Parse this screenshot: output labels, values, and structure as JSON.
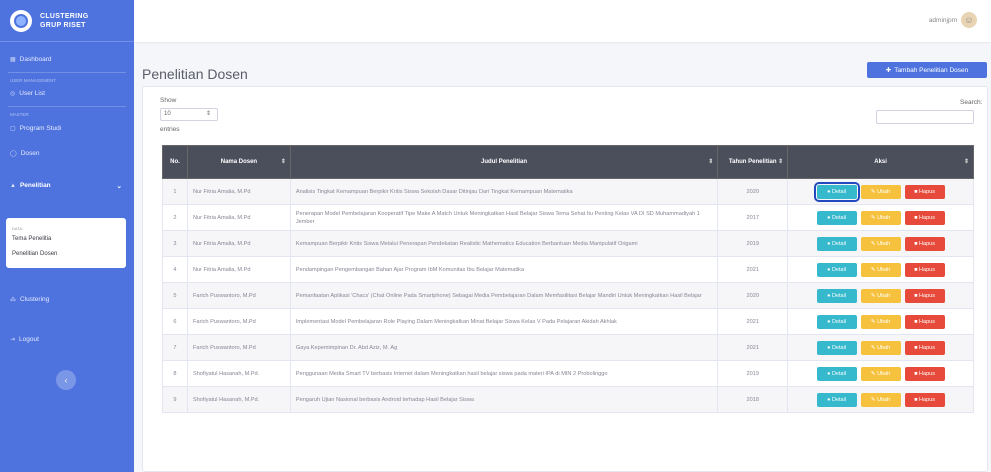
{
  "brand": {
    "line1": "CLUSTERING",
    "line2": "GRUP RISET"
  },
  "sidebar": {
    "dashboard": "Dashboard",
    "heading_user": "USER MANAGEMENT",
    "user_list": "User List",
    "heading_master": "MASTER",
    "program_studi": "Program Studi",
    "dosen": "Dosen",
    "penelitian": "Penelitian",
    "submenu_heading": "DATA:",
    "submenu_items": [
      "Tema Penelitia",
      "Penelitian Dosen"
    ],
    "clustering": "Clustering",
    "logout": "Logout",
    "toggle": "‹"
  },
  "topbar": {
    "username": "adminjpm"
  },
  "page": {
    "title": "Penelitian Dosen",
    "add_button": "Tambah Penelitian Dosen"
  },
  "controls": {
    "show": "Show",
    "show_value": "10",
    "entries": "entries",
    "search": "Search:"
  },
  "table": {
    "headers": [
      "No.",
      "Nama Dosen",
      "Judul Penelitian",
      "Tahun Penelitian",
      "Aksi"
    ],
    "actions": {
      "detail": "Detail",
      "ubah": "Ubah",
      "hapus": "Hapus"
    },
    "rows": [
      {
        "no": "1",
        "nama": "Nur Fitria Amalia, M.Pd",
        "judul": "Analisis Tingkat Kemampuan Berpikir Kritis Siswa Sekolah Dasar Ditinjau Dari Tingkat Kemampuan Matematika",
        "tahun": "2020"
      },
      {
        "no": "2",
        "nama": "Nur Fitria Amalia, M.Pd",
        "judul": "Penerapan Model Pembelajaran Kooperatif Tipe Make A Match Untuk Meningkatkan Hasil Belajar Siswa Tema Sehat Itu Penting Kelas VA DI SD Muhammadiyah 1 Jember",
        "tahun": "2017"
      },
      {
        "no": "3",
        "nama": "Nur Fitria Amalia, M.Pd",
        "judul": "Kemampuan Berpikir Kritis Siswa Melalui Penerapan Pendekatan Realistic Mathematics Education Berbantuan Media Manipulatif Origami",
        "tahun": "2019"
      },
      {
        "no": "4",
        "nama": "Nur Fitria Amalia, M.Pd",
        "judul": "Pendampingan Pengembangan Bahan Ajar Program IbM Komunitas Ibu Belajar Matematika",
        "tahun": "2021"
      },
      {
        "no": "5",
        "nama": "Farich Puswantoro, M.Pd",
        "judul": "Pemanfaatan Aplikasi 'Chacs' (Chat Online Pada Smartphone) Sebagai Media Pembelajaran Dalam Memfasilitasi Belajar Mandiri Untuk Meningkatkan Hasil Belajar",
        "tahun": "2020"
      },
      {
        "no": "6",
        "nama": "Farich Puswantoro, M.Pd",
        "judul": "Implementasi Model Pembelajaran Role Playing Dalam Meningkatkan Minat Belajar Siswa Kelas V Pada Pelajaran Akidah Akhlak",
        "tahun": "2021"
      },
      {
        "no": "7",
        "nama": "Farich Puswantoro, M.Pd",
        "judul": "Gaya Kepemimpinan Dr. Abd Aziz, M. Ag",
        "tahun": "2021"
      },
      {
        "no": "8",
        "nama": "Shofiyatul Hasanah, M.Pd.",
        "judul": "Penggunaan Media Smart TV berbasis Internet dalam Meningkatkan hasil belajar siswa pada materi IPA di MIN 2 Probolinggo",
        "tahun": "2019"
      },
      {
        "no": "9",
        "nama": "Shofiyatul Hasanah, M.Pd.",
        "judul": "Pengaruh Ujian Nasional berbasis Android terhadap Hasil Belajar Siswa",
        "tahun": "2018"
      }
    ]
  }
}
